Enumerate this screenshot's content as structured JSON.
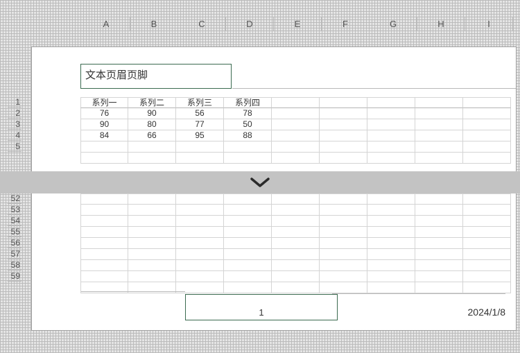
{
  "columns": [
    "A",
    "B",
    "C",
    "D",
    "E",
    "F",
    "G",
    "H",
    "I"
  ],
  "rows_top": [
    "1",
    "2",
    "3",
    "4",
    "5"
  ],
  "rows_bottom": [
    "52",
    "53",
    "54",
    "55",
    "56",
    "57",
    "58",
    "59"
  ],
  "header_text": "文本页眉页脚",
  "table": {
    "headers": [
      "系列一",
      "系列二",
      "系列三",
      "系列四"
    ],
    "rows": [
      [
        "76",
        "90",
        "56",
        "78"
      ],
      [
        "90",
        "80",
        "77",
        "50"
      ],
      [
        "84",
        "66",
        "95",
        "88"
      ]
    ]
  },
  "footer": {
    "center": "1",
    "right": "2024/1/8"
  },
  "chart_data": {
    "type": "table",
    "title": "",
    "columns": [
      "系列一",
      "系列二",
      "系列三",
      "系列四"
    ],
    "rows": [
      [
        76,
        90,
        56,
        78
      ],
      [
        90,
        80,
        77,
        50
      ],
      [
        84,
        66,
        95,
        88
      ]
    ]
  }
}
